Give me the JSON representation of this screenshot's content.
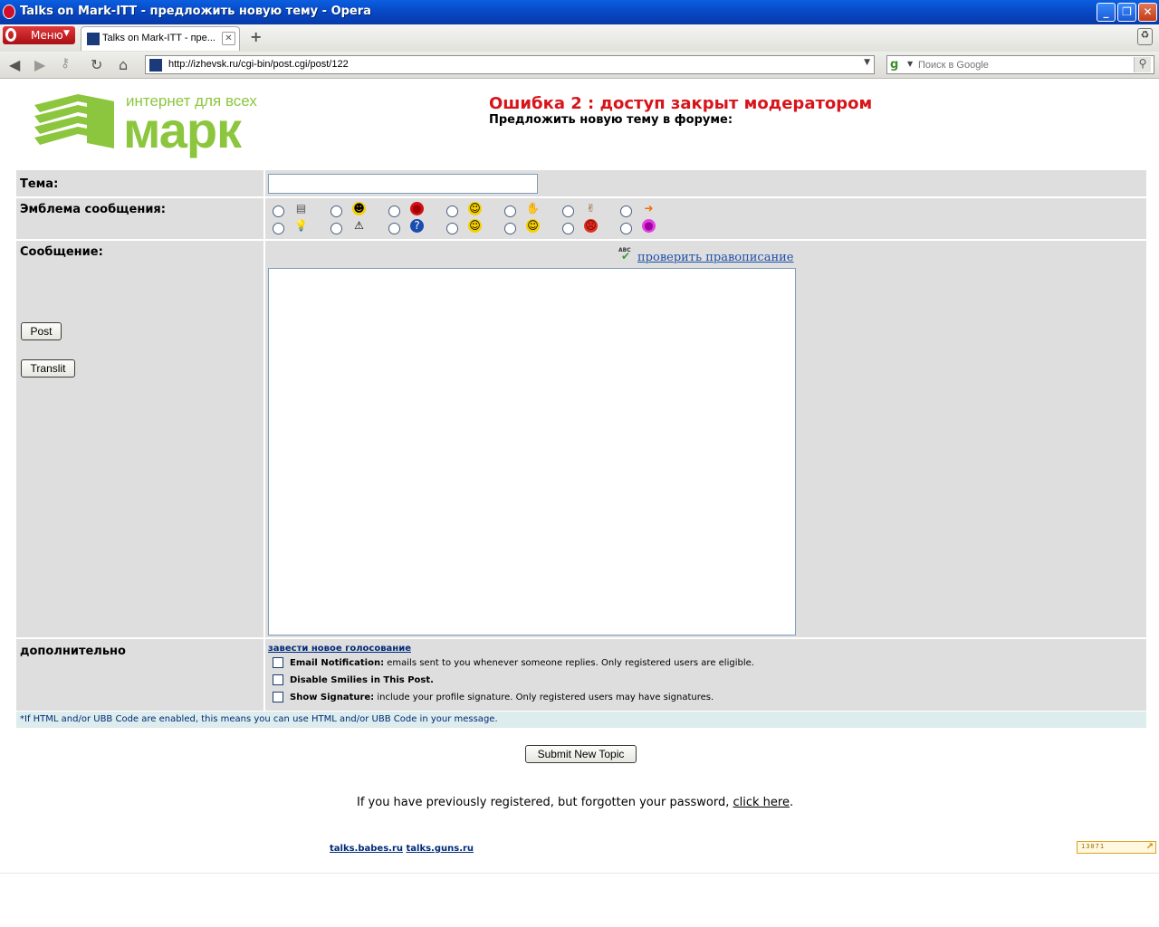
{
  "window": {
    "title": "Talks on Mark-ITT - предложить новую тему - Opera"
  },
  "browser": {
    "menu_label": "Меню",
    "tab_label": "Talks on Mark-ITT - пре...",
    "url": "http://izhevsk.ru/cgi-bin/post.cgi/post/122",
    "search_placeholder": "Поиск в Google"
  },
  "logo": {
    "tagline": "интернет для всех",
    "name": "марк"
  },
  "header": {
    "error_title": "Ошибка 2 : доступ закрыт модератором",
    "subtitle": "Предложить новую тему в форуме:"
  },
  "form": {
    "subject_label": "Тема:",
    "subject_value": "",
    "emblem_label": "Эмблема сообщения:",
    "message_label": "Сообщение:",
    "spellcheck_link": "проверить правописание",
    "post_button": "Post",
    "translit_button": "Translit",
    "extra_label": "дополнительно",
    "poll_link": "завести новое голосование",
    "options": [
      {
        "bold": "Email Notification:",
        "text": " emails sent to you whenever someone replies. Only registered users are eligible."
      },
      {
        "bold": "Disable Smilies in This Post.",
        "text": ""
      },
      {
        "bold": "Show Signature:",
        "text": " include your profile signature. Only registered users may have signatures."
      }
    ],
    "note": "*If HTML and/or UBB Code are enabled, this means you can use HTML and/or UBB Code in your message.",
    "submit_button": "Submit New Topic"
  },
  "emblems": [
    {
      "icon": "note-icon",
      "glyph": "▤",
      "color": "#555555",
      "bg": "transparent"
    },
    {
      "icon": "grin-icon",
      "glyph": "☻",
      "color": "#000000",
      "bg": "#f5d000"
    },
    {
      "icon": "mad-icon",
      "glyph": "●",
      "color": "#a00000",
      "bg": "#d41010"
    },
    {
      "icon": "smile-icon",
      "glyph": "☺",
      "color": "#000000",
      "bg": "#f5d000"
    },
    {
      "icon": "thumbs-down-icon",
      "glyph": "✋",
      "color": "#8a5a2a",
      "bg": "transparent"
    },
    {
      "icon": "thumbs-up-icon",
      "glyph": "✌",
      "color": "#8a5a2a",
      "bg": "transparent"
    },
    {
      "icon": "arrow-icon",
      "glyph": "➜",
      "color": "#f07000",
      "bg": "transparent"
    },
    {
      "icon": "lightbulb-icon",
      "glyph": "💡",
      "color": "#e0b000",
      "bg": "transparent"
    },
    {
      "icon": "warning-icon",
      "glyph": "⚠",
      "color": "#000000",
      "bg": "transparent"
    },
    {
      "icon": "question-icon",
      "glyph": "?",
      "color": "#ffffff",
      "bg": "#1a4db0"
    },
    {
      "icon": "cool-icon",
      "glyph": "☺",
      "color": "#000000",
      "bg": "#f5d000"
    },
    {
      "icon": "happy-icon",
      "glyph": "☺",
      "color": "#000000",
      "bg": "#f5d000"
    },
    {
      "icon": "angry-icon",
      "glyph": "☹",
      "color": "#600000",
      "bg": "#e03020"
    },
    {
      "icon": "blush-icon",
      "glyph": "●",
      "color": "#a000a0",
      "bg": "#e040e0"
    }
  ],
  "footer": {
    "forgot_text": "If you have previously registered, but forgotten your password, ",
    "forgot_link": "click here",
    "forgot_end": ".",
    "link1": "talks.babes.ru",
    "link2": "talks.guns.ru",
    "counter": "13071"
  }
}
